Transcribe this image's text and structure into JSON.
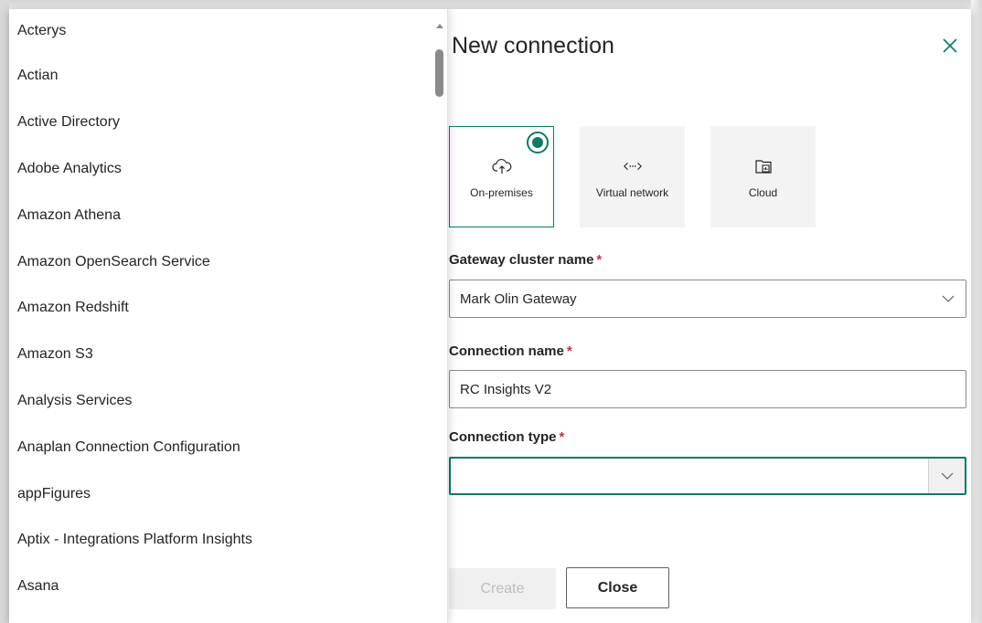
{
  "connector_list": {
    "items": [
      "Acterys",
      "Actian",
      "Active Directory",
      "Adobe Analytics",
      "Amazon Athena",
      "Amazon OpenSearch Service",
      "Amazon Redshift",
      "Amazon S3",
      "Analysis Services",
      "Anaplan Connection Configuration",
      "appFigures",
      "Aptix - Integrations Platform Insights",
      "Asana"
    ]
  },
  "dialog": {
    "title": "New connection",
    "connection_modes": [
      {
        "label": "On-premises",
        "icon": "cloud-upload-icon",
        "selected": true
      },
      {
        "label": "Virtual network",
        "icon": "virtual-network-icon",
        "selected": false
      },
      {
        "label": "Cloud",
        "icon": "cloud-folder-icon",
        "selected": false
      }
    ],
    "gateway_cluster": {
      "label": "Gateway cluster name",
      "required": "*",
      "value": "Mark Olin Gateway"
    },
    "connection_name": {
      "label": "Connection name",
      "required": "*",
      "value": "RC Insights V2"
    },
    "connection_type": {
      "label": "Connection type",
      "required": "*",
      "value": ""
    },
    "buttons": {
      "create": "Create",
      "close": "Close"
    }
  },
  "colors": {
    "accent": "#117865",
    "required": "#c4314b",
    "disabled_text": "#bdbdbd"
  }
}
